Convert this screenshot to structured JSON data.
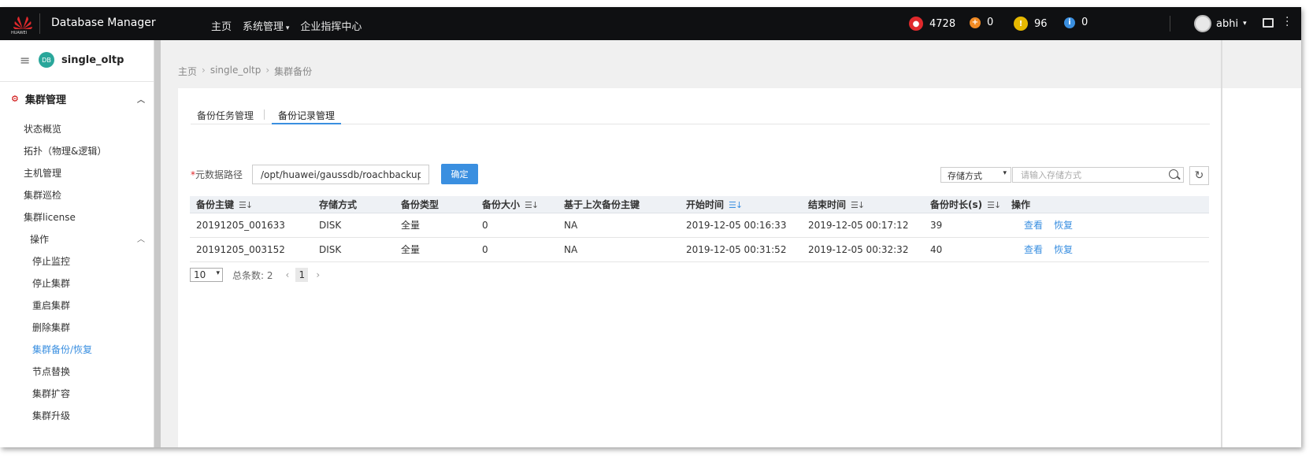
{
  "topbar": {
    "brand_word": "HUAWEI",
    "app_title": "Database Manager",
    "nav": [
      {
        "label": "主页",
        "dropdown": false
      },
      {
        "label": "系统管理",
        "dropdown": true
      },
      {
        "label": "企业指挥中心",
        "dropdown": false
      }
    ],
    "stats": [
      {
        "icon": "critical-alarm-icon",
        "color": "#e0292c",
        "value": "4728"
      },
      {
        "icon": "major-alarm-icon",
        "color": "#f08a24",
        "value": "0"
      },
      {
        "icon": "minor-alarm-icon",
        "color": "#e6b800",
        "value": "96"
      },
      {
        "icon": "info-alarm-icon",
        "color": "#3a8fe0",
        "value": "0"
      }
    ],
    "username": "abhi"
  },
  "sidebar": {
    "db_name": "single_oltp",
    "db_icon_text": "DB",
    "group_label": "集群管理",
    "items": [
      {
        "label": "状态概览"
      },
      {
        "label": "拓扑（物理&逻辑）"
      },
      {
        "label": "主机管理"
      },
      {
        "label": "集群巡检"
      },
      {
        "label": "集群license"
      }
    ],
    "ops_label": "操作",
    "ops_items": [
      {
        "label": "停止监控",
        "active": false
      },
      {
        "label": "停止集群",
        "active": false
      },
      {
        "label": "重启集群",
        "active": false
      },
      {
        "label": "删除集群",
        "active": false
      },
      {
        "label": "集群备份/恢复",
        "active": true
      },
      {
        "label": "节点替换",
        "active": false
      },
      {
        "label": "集群扩容",
        "active": false
      },
      {
        "label": "集群升级",
        "active": false
      }
    ]
  },
  "breadcrumb": [
    "主页",
    "single_oltp",
    "集群备份"
  ],
  "tabs": [
    {
      "label": "备份任务管理",
      "active": false
    },
    {
      "label": "备份记录管理",
      "active": true
    }
  ],
  "path_form": {
    "label": "元数据路径",
    "value": "/opt/huawei/gaussdb/roachbackup",
    "confirm_label": "确定"
  },
  "filter": {
    "select_value": "存储方式",
    "search_placeholder": "请输入存储方式"
  },
  "table": {
    "columns": [
      {
        "label": "备份主键",
        "sortable": true,
        "active": false
      },
      {
        "label": "存储方式",
        "sortable": false,
        "active": false
      },
      {
        "label": "备份类型",
        "sortable": false,
        "active": false
      },
      {
        "label": "备份大小",
        "sortable": true,
        "active": false
      },
      {
        "label": "基于上次备份主键",
        "sortable": false,
        "active": false
      },
      {
        "label": "开始时间",
        "sortable": true,
        "active": true
      },
      {
        "label": "结束时间",
        "sortable": true,
        "active": false
      },
      {
        "label": "备份时长(s)",
        "sortable": true,
        "active": false
      },
      {
        "label": "操作",
        "sortable": false,
        "active": false
      }
    ],
    "rows": [
      [
        "20191205_001633",
        "DISK",
        "全量",
        "0",
        "NA",
        "2019-12-05 00:16:33",
        "2019-12-05 00:17:12",
        "39"
      ],
      [
        "20191205_003152",
        "DISK",
        "全量",
        "0",
        "NA",
        "2019-12-05 00:31:52",
        "2019-12-05 00:32:32",
        "40"
      ]
    ],
    "actions": [
      "查看",
      "恢复"
    ]
  },
  "pager": {
    "page_size": "10",
    "total_text": "总条数: 2",
    "current_page": "1"
  }
}
